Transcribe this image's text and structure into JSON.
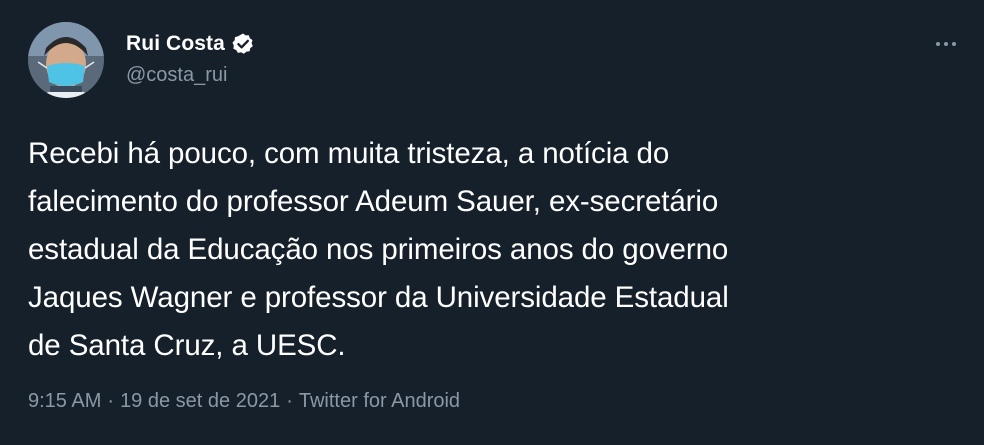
{
  "author": {
    "display_name": "Rui Costa",
    "handle": "@costa_rui",
    "verified": true,
    "avatar_icon": "profile-photo-with-face-mask"
  },
  "menu_icon": "more-horizontal-icon",
  "tweet": {
    "lines": [
      "Recebi há pouco, com muita tristeza, a notícia do",
      "falecimento do professor Adeum Sauer, ex-secretário",
      "estadual da Educação nos primeiros anos do governo",
      "Jaques Wagner e professor da Universidade Estadual",
      "de Santa Cruz, a UESC."
    ]
  },
  "meta": {
    "time": "9:15 AM",
    "separator": "·",
    "date": "19 de set de 2021",
    "source": "Twitter for Android"
  },
  "colors": {
    "background": "#15202b",
    "text": "#ffffff",
    "secondary": "#8b98a5",
    "verified_badge": "#ffffff"
  }
}
